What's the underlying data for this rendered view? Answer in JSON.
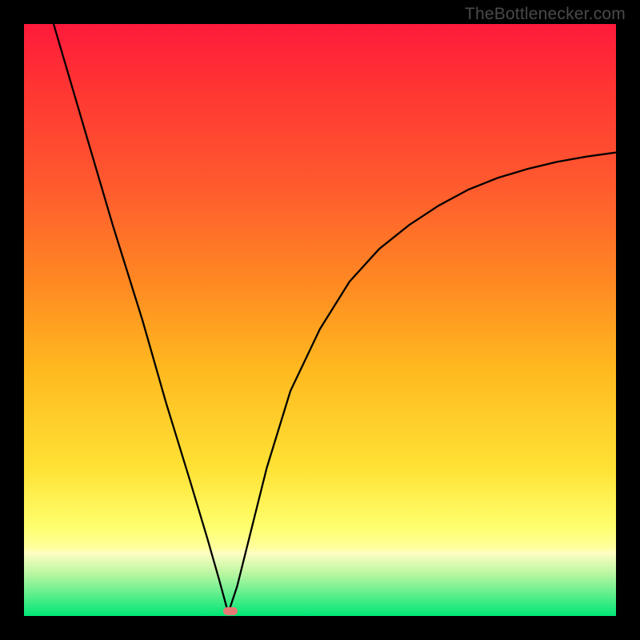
{
  "watermark": {
    "text": "TheBottlenecker.com"
  },
  "marker": {
    "x_pct": 34.8,
    "y_pct": 99.2,
    "color": "#e77a74"
  },
  "chart_data": {
    "type": "line",
    "title": "",
    "xlabel": "",
    "ylabel": "",
    "xlim": [
      0,
      100
    ],
    "ylim": [
      0,
      100
    ],
    "grid": false,
    "legend": false,
    "series": [
      {
        "name": "curve",
        "x": [
          5.0,
          10.0,
          15.0,
          20.0,
          24.0,
          28.0,
          31.0,
          33.0,
          34.5,
          36.0,
          38.0,
          41.0,
          45.0,
          50.0,
          55.0,
          60.0,
          65.0,
          70.0,
          75.0,
          80.0,
          85.0,
          90.0,
          95.0,
          100.0
        ],
        "values": [
          100.0,
          83.0,
          66.0,
          50.0,
          36.0,
          23.0,
          13.0,
          6.0,
          0.5,
          5.0,
          13.0,
          25.0,
          38.0,
          48.5,
          56.5,
          62.0,
          66.0,
          69.3,
          72.0,
          74.0,
          75.5,
          76.7,
          77.6,
          78.3
        ]
      }
    ],
    "minimum_marker": {
      "x": 34.8,
      "y": 0.8
    }
  }
}
